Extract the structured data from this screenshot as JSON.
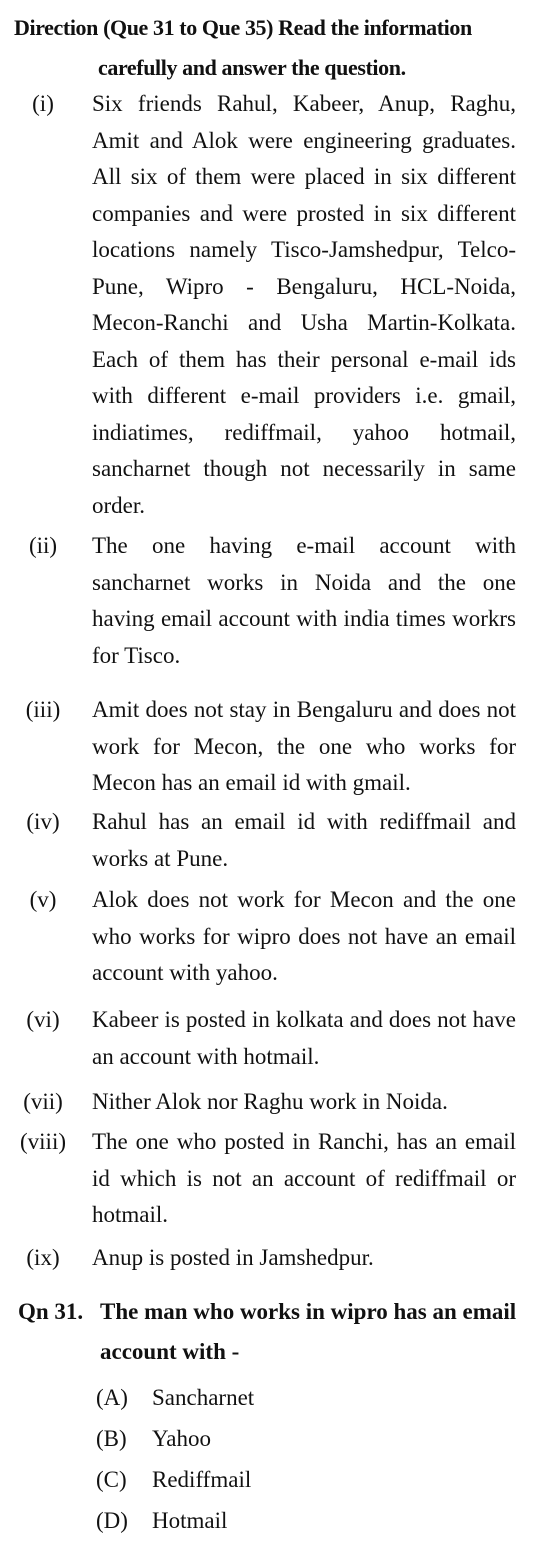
{
  "direction": {
    "line1": "Direction (Que 31 to Que 35) Read the information",
    "line2": "carefully and answer the question."
  },
  "items": [
    {
      "num": "(i)",
      "text": "Six friends Rahul, Kabeer, Anup, Raghu, Amit and Alok were engineering graduates. All six of them were placed in six different companies and were prosted in six different locations namely Tisco-Jamshedpur, Telco-Pune, Wipro - Bengaluru, HCL-Noida, Mecon-Ranchi and Usha Martin-Kolkata. Each of them has their personal e-mail ids with different e-mail providers i.e. gmail, indiatimes, rediffmail, yahoo hotmail, sancharnet though not necessarily in same order."
    },
    {
      "num": "(ii)",
      "text": "The one having e-mail account with sancharnet works in Noida and the one having email account with india times workrs for Tisco."
    },
    {
      "num": "(iii)",
      "text": "Amit does not stay in Bengaluru and does not work for Mecon, the one who works for Mecon has an email id with gmail."
    },
    {
      "num": "(iv)",
      "text": "Rahul has an email id with rediffmail and works at Pune."
    },
    {
      "num": "(v)",
      "text": "Alok does not work for Mecon and the one who works for wipro does not have an email account with yahoo."
    },
    {
      "num": "(vi)",
      "text": "Kabeer is posted in kolkata and does not have an account with hotmail."
    },
    {
      "num": "(vii)",
      "text": "Nither Alok nor Raghu work in Noida."
    },
    {
      "num": "(viii)",
      "text": "The one who posted in Ranchi, has an email id which is not an account of rediffmail or hotmail."
    },
    {
      "num": "(ix)",
      "text": "Anup is posted in Jamshedpur."
    }
  ],
  "question": {
    "number": "Qn 31.",
    "text": "The man who works in wipro has an email account with -"
  },
  "options": [
    {
      "label": "(A)",
      "text": "Sancharnet"
    },
    {
      "label": "(B)",
      "text": "Yahoo"
    },
    {
      "label": "(C)",
      "text": "Rediffmail"
    },
    {
      "label": "(D)",
      "text": "Hotmail"
    }
  ]
}
